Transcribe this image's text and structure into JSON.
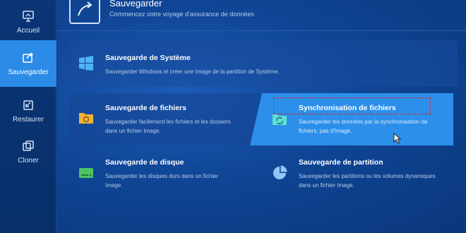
{
  "sidebar": {
    "items": [
      {
        "label": "Accueil",
        "icon": "home-monitor-icon"
      },
      {
        "label": "Sauvegarder",
        "icon": "backup-icon",
        "active": true
      },
      {
        "label": "Restaurer",
        "icon": "restore-icon"
      },
      {
        "label": "Cloner",
        "icon": "clone-icon"
      }
    ]
  },
  "header": {
    "title": "Sauvegarder",
    "subtitle": "Commencez votre voyage d'assurance de données",
    "icon": "backup-arrow-icon"
  },
  "cards": {
    "system": {
      "title": "Sauvegarde de Système",
      "desc": "Sauvegarder Windows et créer une Image de la partition de Système.",
      "icon": "windows-icon"
    },
    "files": {
      "title": "Sauvegarde de fichiers",
      "desc1": "Sauvegarder facilement les fichiers et les dossiers",
      "desc2": "dans un fichier Image.",
      "icon": "folder-icon"
    },
    "sync": {
      "title": "Synchronisation de fichiers",
      "desc1": "Sauvegarder les données par la synchronisation de",
      "desc2": "fichiers, pas d'Image.",
      "icon": "sync-folder-icon"
    },
    "disk": {
      "title": "Sauvegarde de disque",
      "desc1": "Sauvegarder les disques durs dans un fichier",
      "desc2": "Image.",
      "icon": "disk-icon"
    },
    "partition": {
      "title": "Sauvegarde de partition",
      "desc1": "Sauvegarder les partitions ou les volumes dynamiques",
      "desc2": "dans un fichier Image.",
      "icon": "partition-pie-icon"
    }
  },
  "colors": {
    "accent": "#2c8fea",
    "background": "#0d3a7e",
    "highlight_border": "#e0202a"
  }
}
